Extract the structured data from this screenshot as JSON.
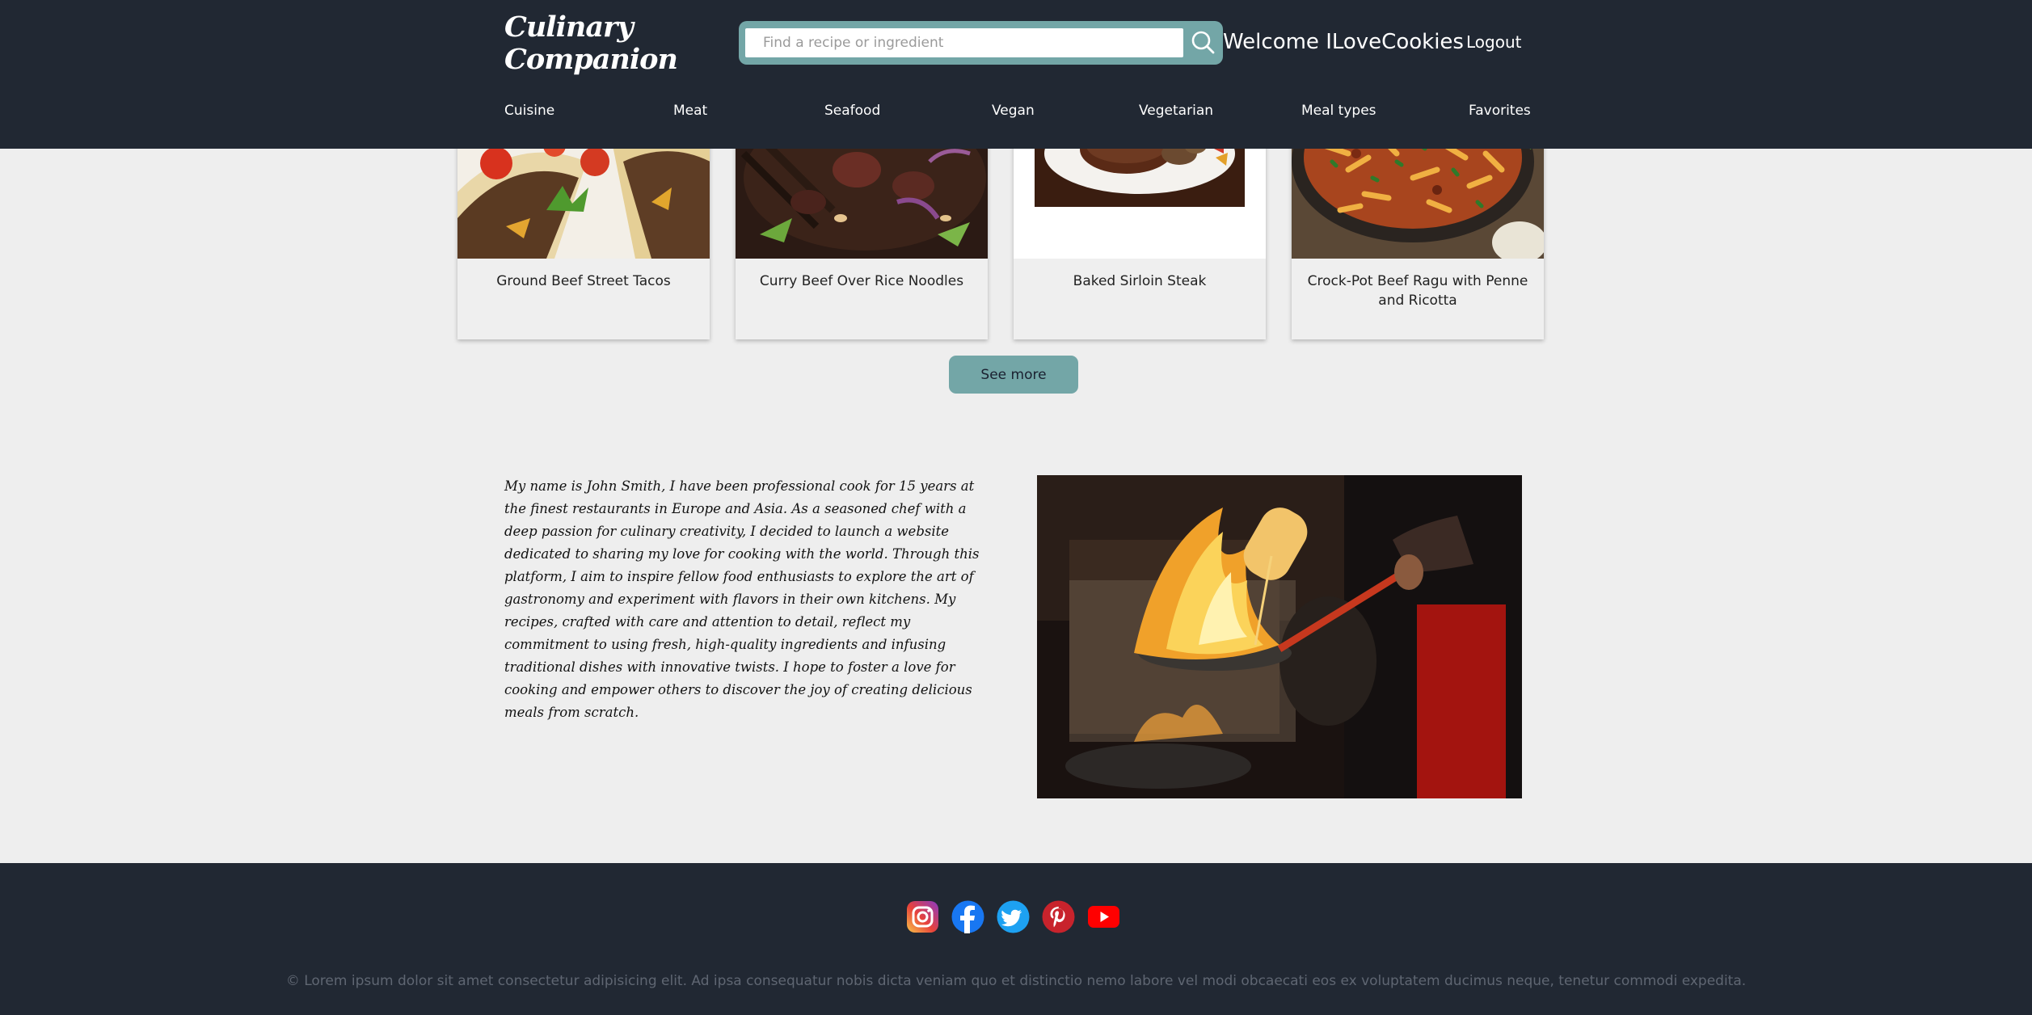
{
  "header": {
    "logo_line1": "Culinary",
    "logo_line2": "Companion",
    "search_placeholder": "Find a recipe or ingredient",
    "welcome": "Welcome ILoveCookies",
    "logout": "Logout"
  },
  "nav": [
    "Cuisine",
    "Meat",
    "Seafood",
    "Vegan",
    "Vegetarian",
    "Meal types",
    "Favorites"
  ],
  "cards": [
    {
      "title": "Ground Beef Street Tacos"
    },
    {
      "title": "Curry Beef Over Rice Noodles"
    },
    {
      "title": "Baked Sirloin Steak"
    },
    {
      "title": "Crock-Pot Beef Ragu with Penne and Ricotta"
    }
  ],
  "see_more": "See more",
  "about": {
    "text": "My name is John Smith, I have been professional cook for 15 years at the finest restaurants in Europe and Asia. As a seasoned chef with a deep passion for culinary creativity, I decided to launch a website dedicated to sharing my love for cooking with the world. Through this platform, I aim to inspire fellow food enthusiasts to explore the art of gastronomy and experiment with flavors in their own kitchens. My recipes, crafted with care and attention to detail, reflect my commitment to using fresh, high-quality ingredients and infusing traditional dishes with innovative twists. I hope to foster a love for cooking and empower others to discover the joy of creating delicious meals from scratch."
  },
  "footer": {
    "social": [
      "instagram-icon",
      "facebook-icon",
      "twitter-icon",
      "pinterest-icon",
      "youtube-icon"
    ],
    "copyright": "© Lorem ipsum dolor sit amet consectetur adipisicing elit. Ad ipsa consequatur nobis dicta veniam quo et distinctio nemo labore vel modi obcaecati eos ex voluptatem ducimus neque, tenetur commodi expedita."
  },
  "colors": {
    "header_bg": "#212833",
    "accent": "#73a6a7",
    "page_bg": "#eeeeee"
  }
}
